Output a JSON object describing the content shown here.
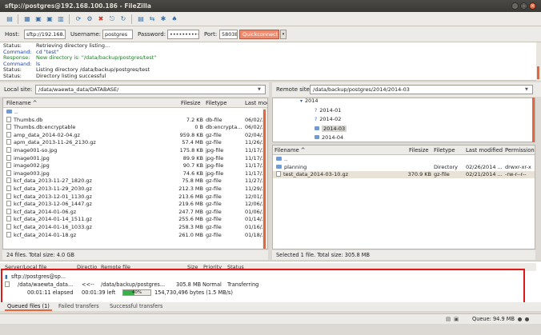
{
  "window": {
    "title": "sftp://postgres@192.168.100.186 - FileZilla",
    "controls": [
      "–",
      "□",
      "×"
    ]
  },
  "quickconnect": {
    "host_label": "Host:",
    "host_value": "sftp://192.168.",
    "username_label": "Username:",
    "username_value": "postgres",
    "password_label": "Password:",
    "password_value": "••••••••••",
    "port_label": "Port:",
    "port_value": "58038",
    "button_label": "Quickconnect",
    "dropdown_glyph": "▾"
  },
  "log": [
    {
      "key": "Status:",
      "value": "Retrieving directory listing...",
      "type": "status"
    },
    {
      "key": "Command:",
      "value": "cd \"test\"",
      "type": "command"
    },
    {
      "key": "Response:",
      "value": "New directory is: \"/data/backup/postgres/test\"",
      "type": "response"
    },
    {
      "key": "Command:",
      "value": "ls",
      "type": "command"
    },
    {
      "key": "Status:",
      "value": "Listing directory /data/backup/postgres/test",
      "type": "status"
    },
    {
      "key": "Status:",
      "value": "Directory listing successful",
      "type": "status"
    }
  ],
  "local": {
    "site_label": "Local site:",
    "site_path": "/data/waewta_data/DATABASE/",
    "columns": {
      "name": "Filename ^",
      "size": "Filesize",
      "type": "Filetype",
      "modified": "Last mod"
    },
    "files": [
      {
        "name": "..",
        "size": "",
        "type": "",
        "modified": "",
        "folder": true
      },
      {
        "name": "Thumbs.db",
        "size": "7.2 KB",
        "type": "db-file",
        "modified": "06/02/20"
      },
      {
        "name": "Thumbs.db:encryptable",
        "size": "0 B",
        "type": "db:encrypta...",
        "modified": "06/02/20"
      },
      {
        "name": "amp_data_2014-02-04.gz",
        "size": "959.8 KB",
        "type": "gz-file",
        "modified": "02/04/20"
      },
      {
        "name": "apm_data_2013-11-26_2130.gz",
        "size": "57.4 MB",
        "type": "gz-file",
        "modified": "11/26/20"
      },
      {
        "name": "image001-so.jpg",
        "size": "175.8 KB",
        "type": "jpg-file",
        "modified": "11/17/20"
      },
      {
        "name": "image001.jpg",
        "size": "89.9 KB",
        "type": "jpg-file",
        "modified": "11/17/20"
      },
      {
        "name": "image002.jpg",
        "size": "90.7 KB",
        "type": "jpg-file",
        "modified": "11/17/20"
      },
      {
        "name": "image003.jpg",
        "size": "74.6 KB",
        "type": "jpg-file",
        "modified": "11/17/20"
      },
      {
        "name": "kcf_data_2013-11-27_1820.gz",
        "size": "75.8 MB",
        "type": "gz-file",
        "modified": "11/27/20"
      },
      {
        "name": "kcf_data_2013-11-29_2030.gz",
        "size": "212.3 MB",
        "type": "gz-file",
        "modified": "11/29/20"
      },
      {
        "name": "kcf_data_2013-12-01_1130.gz",
        "size": "213.6 MB",
        "type": "gz-file",
        "modified": "12/01/20"
      },
      {
        "name": "kcf_data_2013-12-06_1447.gz",
        "size": "219.6 MB",
        "type": "gz-file",
        "modified": "12/06/20"
      },
      {
        "name": "kcf_data_2014-01-06.gz",
        "size": "247.7 MB",
        "type": "gz-file",
        "modified": "01/06/20"
      },
      {
        "name": "kcf_data_2014-01-14_1511.gz",
        "size": "255.6 MB",
        "type": "gz-file",
        "modified": "01/14/20"
      },
      {
        "name": "kcf_data_2014-01-16_1033.gz",
        "size": "258.3 MB",
        "type": "gz-file",
        "modified": "01/16/20"
      },
      {
        "name": "kcf_data_2014-01-18.gz",
        "size": "261.0 MB",
        "type": "gz-file",
        "modified": "01/18/20"
      }
    ],
    "status": "24 files. Total size: 4.0 GB"
  },
  "remote": {
    "site_label": "Remote site:",
    "site_path": "/data/backup/postgres/2014/2014-03",
    "tree": [
      {
        "label": "2014",
        "mark": "▾"
      },
      {
        "label": "2014-01",
        "mark": "?"
      },
      {
        "label": "2014-02",
        "mark": "?"
      },
      {
        "label": "2014-03",
        "mark": "",
        "selected": true
      },
      {
        "label": "2014-04",
        "mark": ""
      }
    ],
    "columns": {
      "name": "Filename ^",
      "size": "Filesize",
      "type": "Filetype",
      "modified": "Last modified",
      "perm": "Permission"
    },
    "files": [
      {
        "name": "..",
        "size": "",
        "type": "",
        "modified": "",
        "perm": "",
        "folder": true
      },
      {
        "name": "planning",
        "size": "",
        "type": "Directory",
        "modified": "02/26/2014 ...",
        "perm": "drwxr-xr-x",
        "folder": true
      },
      {
        "name": "test_data_2014-03-10.gz",
        "size": "370.9 KB",
        "type": "gz-file",
        "modified": "02/21/2014 ...",
        "perm": "-rw-r--r--",
        "selected": true
      }
    ],
    "status": "Selected 1 file. Total size: 305.8 MB"
  },
  "queue": {
    "columns": {
      "server": "Server/Local file",
      "direction": "Directio",
      "remote": "Remote file",
      "size": "Size",
      "priority": "Priority",
      "status": "Status"
    },
    "server": "sftp://postgres@sp...",
    "local_file": "/data/waewta_data...",
    "direction": "<<--",
    "remote_file": "/data/backup/postgres...",
    "size": "305.8 MB",
    "priority": "Normal",
    "status": "Transferring",
    "elapsed": "00:01:11 elapsed",
    "left": "00:01:39 left",
    "progress_percent": 40,
    "progress_label": "40%",
    "bytes": "154,730,496 bytes (1.5 MB/s)"
  },
  "tabs": [
    {
      "label": "Queued files (1)",
      "active": true
    },
    {
      "label": "Failed transfers",
      "active": false
    },
    {
      "label": "Successful transfers",
      "active": false
    }
  ],
  "statusbar": {
    "queue": "Queue: 94.9 MB"
  },
  "colors": {
    "accent": "#e8663b",
    "highlight_box": "#e01818",
    "progress": "#3bb04a"
  }
}
